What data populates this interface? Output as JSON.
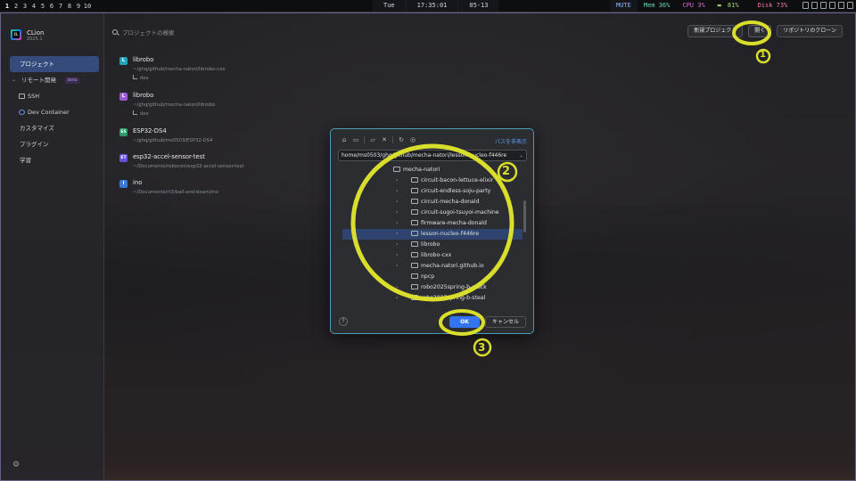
{
  "system_bar": {
    "workspaces": [
      "1",
      "2",
      "3",
      "4",
      "5",
      "6",
      "7",
      "8",
      "9",
      "10"
    ],
    "day": "Tue",
    "time": "17:35:01",
    "date": "05-13",
    "mute": "MUTE",
    "mem": "Mem 36%",
    "cpu": "CPU  3%",
    "battery": "81%",
    "disk": "Disk 73%"
  },
  "app": {
    "name": "CLion",
    "version": "2025.1",
    "logo_text": "CL"
  },
  "sidebar": {
    "items": [
      {
        "label": "プロジェクト"
      },
      {
        "label": "リモート開発",
        "badge": "Beta"
      },
      {
        "label": "SSH"
      },
      {
        "label": "Dev Container"
      },
      {
        "label": "カスタマイズ"
      },
      {
        "label": "プラグイン"
      },
      {
        "label": "学習"
      }
    ]
  },
  "header": {
    "search_placeholder": "プロジェクトの検索",
    "new_project": "新規プロジェクト",
    "open": "開く",
    "clone": "リポジトリのクローン"
  },
  "projects": [
    {
      "badge": "L",
      "color": "#1fa3b8",
      "name": "librobo",
      "path": "~/ghq/github/mecha-natori/librobo-cxx",
      "branch": "dev"
    },
    {
      "badge": "L",
      "color": "#9b59d6",
      "name": "librobo",
      "path": "~/ghq/github/mecha-natori/librobo",
      "branch": "dev"
    },
    {
      "badge": "ES",
      "color": "#2e9a6a",
      "name": "ESP32-DS4",
      "path": "~/ghq/github/ms0503/ESP32-DS4",
      "branch": ""
    },
    {
      "badge": "ET",
      "color": "#6a4fd8",
      "name": "esp32-accel-sensor-test",
      "path": "~/Documents/robocon/esp32-accel-sensor-test",
      "branch": ""
    },
    {
      "badge": "I",
      "color": "#3a78d8",
      "name": "ino",
      "path": "~/Documents/rt3/ball-and-beam/ino",
      "branch": ""
    }
  ],
  "dialog": {
    "hide_path": "パスを非表示",
    "path_value": "home/ms0503/ghq/github/mecha-natori/lesson-nucleo-f446re",
    "tree_root": "mecha-natori",
    "tree_items": [
      "circuit-bacon-lettuce-elixir",
      "circuit-endless-soju-party",
      "circuit-mecha-donald",
      "circuit-sugoi-tsuyoi-machine",
      "firmware-mecha-donald",
      "lesson-nucleo-f446re",
      "librobo",
      "librobo-cxx",
      "mecha-natori.github.io",
      "npcp",
      "robo2025spring-b-stack",
      "robo2025spring-b-steal"
    ],
    "selected_index": 5,
    "help": "?",
    "ok": "OK",
    "cancel": "キャンセル"
  },
  "annotations": {
    "marker_color": "#d9dd2b",
    "labels": [
      "1",
      "2",
      "3"
    ]
  }
}
